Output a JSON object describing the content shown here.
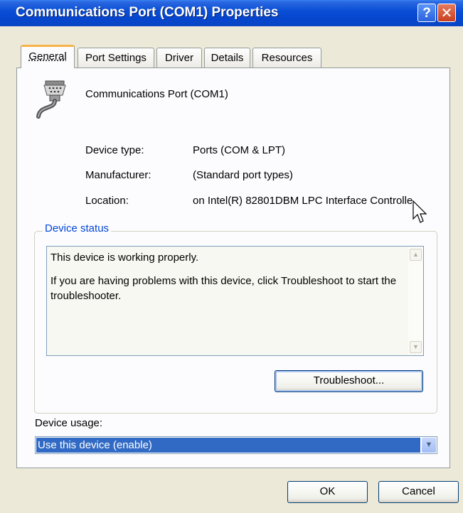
{
  "window": {
    "title": "Communications Port (COM1) Properties"
  },
  "titlebar": {
    "help_label": "?",
    "close_label": "✕"
  },
  "tabs": [
    {
      "label": "General",
      "active": true
    },
    {
      "label": "Port Settings"
    },
    {
      "label": "Driver"
    },
    {
      "label": "Details"
    },
    {
      "label": "Resources"
    }
  ],
  "device": {
    "icon": "serial-port-icon",
    "name": "Communications Port (COM1)",
    "fields": [
      {
        "label": "Device type:",
        "value": "Ports (COM & LPT)"
      },
      {
        "label": "Manufacturer:",
        "value": "(Standard port types)"
      },
      {
        "label": "Location:",
        "value": "on Intel(R) 82801DBM LPC Interface Controlle"
      }
    ]
  },
  "status": {
    "group_title": "Device status",
    "line1": "This device is working properly.",
    "line2": "If you are having problems with this device, click Troubleshoot to start the troubleshooter.",
    "troubleshoot_label": "Troubleshoot..."
  },
  "usage": {
    "label": "Device usage:",
    "selected": "Use this device (enable)"
  },
  "footer": {
    "ok_label": "OK",
    "cancel_label": "Cancel"
  },
  "colors": {
    "title_blue": "#0a4fd6",
    "accent_tab": "#f8b347",
    "group_title": "#0046d5",
    "selection": "#316ac5"
  }
}
